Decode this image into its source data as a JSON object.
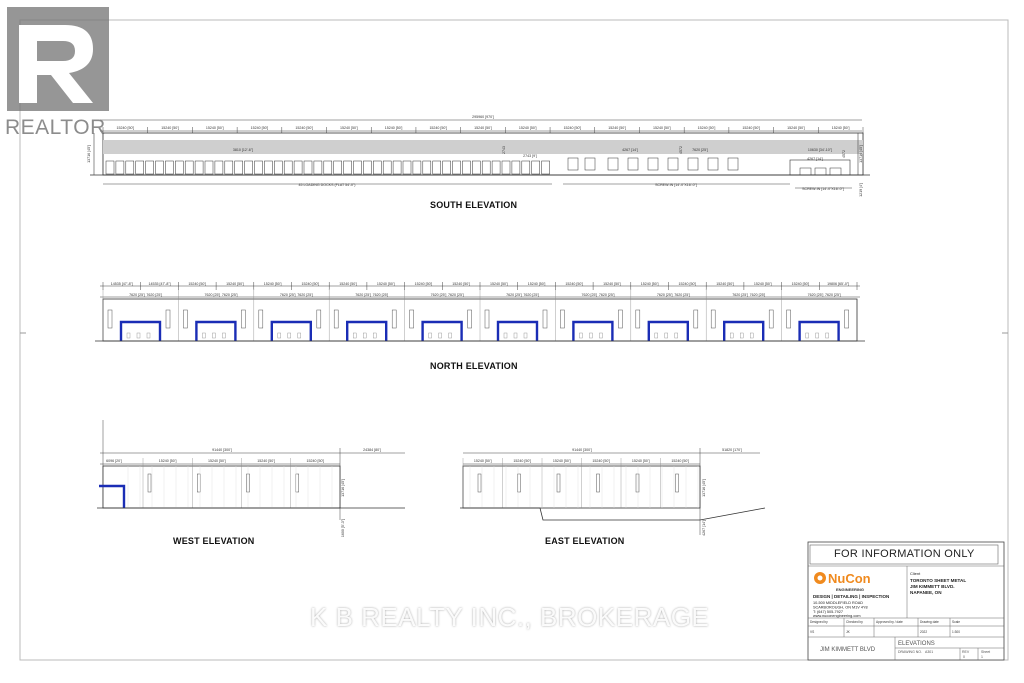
{
  "views": {
    "south": "SOUTH ELEVATION",
    "north": "NORTH ELEVATION",
    "west": "WEST ELEVATION",
    "east": "EAST ELEVATION"
  },
  "south_dims": {
    "overall": "295960 [970']",
    "segments": [
      "15240 [50']",
      "15240 [50']",
      "15240 [50']",
      "15240 [50']",
      "15240 [50']",
      "15240 [50']",
      "15240 [50']",
      "15240 [50']",
      "15240 [50']",
      "15240 [50']",
      "15240 [50']",
      "15240 [50']",
      "15240 [50']",
      "15240 [50']",
      "15240 [50']",
      "15240 [50']",
      "15240 [50']"
    ],
    "height_left": "13716 [45']",
    "height_right": "13716 [45']",
    "docks": "45 LOADING DOCKS (FLAT 54'-0\")",
    "drive_in": "SCREW-IN [14'-0\"X16'-0\"]",
    "drive_in_small": "SCREW-IN [14'-0\"X16'-0\"]",
    "note_a": "3810 [12'-6\"]",
    "note_b": "2743 [9']",
    "note_c": "4267 [14']",
    "note_d": "7620 [25']",
    "note_e": "10630 [34'-10\"]",
    "note_f": "4267 [14']",
    "grade": "1219 [4']"
  },
  "north_dims": {
    "segments": [
      "14535 [47'-8\"]",
      "14535 [47'-8\"]",
      "15240 [50']",
      "15240 [50']",
      "15240 [50']",
      "15240 [50']",
      "15240 [50']",
      "15240 [50']",
      "15240 [50']",
      "15240 [50']",
      "15240 [50']",
      "15240 [50']",
      "15240 [50']",
      "15240 [50']",
      "15240 [50']",
      "15240 [50']",
      "15240 [50']",
      "15240 [50']",
      "15240 [50']",
      "19806 [65'-0\"]"
    ],
    "sub": "7620 [25']"
  },
  "west_dims": {
    "overall": "91440 [300']",
    "right": "24384 [80']",
    "segments": [
      "15240 [50']",
      "15240 [50']",
      "15240 [50']",
      "15240 [50']"
    ],
    "left": "6096 [20']",
    "height": "13716 [45']",
    "grade": "1600 [5'-3\"]"
  },
  "east_dims": {
    "overall": "91440 [300']",
    "right": "51820 [170']",
    "segments": [
      "15240 [50']",
      "15240 [50']",
      "15240 [50']",
      "15240 [50']",
      "15240 [50']",
      "15240 [50']"
    ],
    "height": "13716 [45']",
    "grade": "4267 [14']"
  },
  "title_block": {
    "banner": "FOR INFORMATION ONLY",
    "company_a": "NuCon",
    "company_b": "ENGINEERING",
    "services": "DESIGN | DETAILING | INSPECTION",
    "address_1": "10-500 MIDDLEFIELD ROAD",
    "address_2": "SCARBOROUGH, ON M1V 4Y8",
    "phone": "T: (647) 505-7927",
    "web": "www.nuconengineering.com",
    "client_label": "Client",
    "client_1": "TORONTO SHEET METAL",
    "client_2": "JIM KIMMETT BLVD.",
    "client_3": "NAPANEE, ON",
    "row_labels": [
      "Designed by",
      "Checked by",
      "Approved by / date",
      "Drawing date",
      "Scale"
    ],
    "row_values": [
      "VS",
      "JK",
      "",
      "2022",
      "1:300"
    ],
    "project": "JIM KIMMETT BLVD",
    "title": "ELEVATIONS",
    "drawing_no_label": "DRAWING NO.",
    "drawing_no": "A301",
    "rev_label": "REV",
    "rev": "0",
    "sheet_label": "Sheet",
    "sheet": "1"
  },
  "watermark": {
    "brand": "REALTOR",
    "brokerage": "K B REALTY INC., BROKERAGE"
  },
  "colors": {
    "door_blue": "#1a2db5",
    "line": "#333333",
    "roof_band": "#cfcfcf"
  }
}
